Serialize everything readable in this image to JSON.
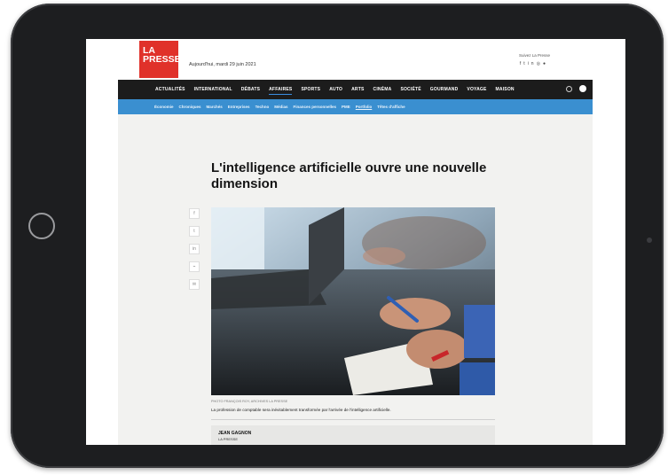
{
  "logo": {
    "line1": "LA",
    "line2": "PRESSE"
  },
  "header": {
    "date": "Aujourd'hui, mardi 29 juin 2021",
    "follow": "Suivez La Presse",
    "social_icons": [
      "facebook-icon",
      "twitter-icon",
      "linkedin-icon",
      "instagram-icon",
      "pinterest-icon"
    ]
  },
  "nav_main": {
    "items": [
      {
        "label": "ACTUALITÉS"
      },
      {
        "label": "INTERNATIONAL"
      },
      {
        "label": "DÉBATS"
      },
      {
        "label": "AFFAIRES",
        "active": true
      },
      {
        "label": "SPORTS"
      },
      {
        "label": "AUTO"
      },
      {
        "label": "ARTS"
      },
      {
        "label": "CINÉMA"
      },
      {
        "label": "SOCIÉTÉ"
      },
      {
        "label": "GOURMAND"
      },
      {
        "label": "VOYAGE"
      },
      {
        "label": "MAISON"
      }
    ]
  },
  "nav_sub": {
    "items": [
      {
        "label": "Économie"
      },
      {
        "label": "Chroniques"
      },
      {
        "label": "Marchés"
      },
      {
        "label": "Entreprises"
      },
      {
        "label": "Techno"
      },
      {
        "label": "Médias"
      },
      {
        "label": "Finances personnelles"
      },
      {
        "label": "PME"
      },
      {
        "label": "Portfolio",
        "active": true
      },
      {
        "label": "Têtes d'affiche"
      }
    ]
  },
  "article": {
    "headline": "L'intelligence artificielle ouvre une nouvelle dimension",
    "photo_credit": "PHOTO FRANÇOIS ROY, ARCHIVES LA PRESSE",
    "caption": "La profession de comptable sera inévitablement transformée par l'arrivée de l'intelligence artificielle.",
    "author": "JEAN GAGNON",
    "publication": "LA PRESSE"
  },
  "share": {
    "buttons": [
      "f",
      "t",
      "in",
      "link",
      "mail"
    ],
    "icon_names": [
      "facebook-icon",
      "twitter-icon",
      "linkedin-icon",
      "link-icon",
      "email-icon"
    ]
  },
  "colors": {
    "brand_red": "#e0312a",
    "nav_dark": "#1c1c1c",
    "nav_blue": "#3a8fd0"
  }
}
